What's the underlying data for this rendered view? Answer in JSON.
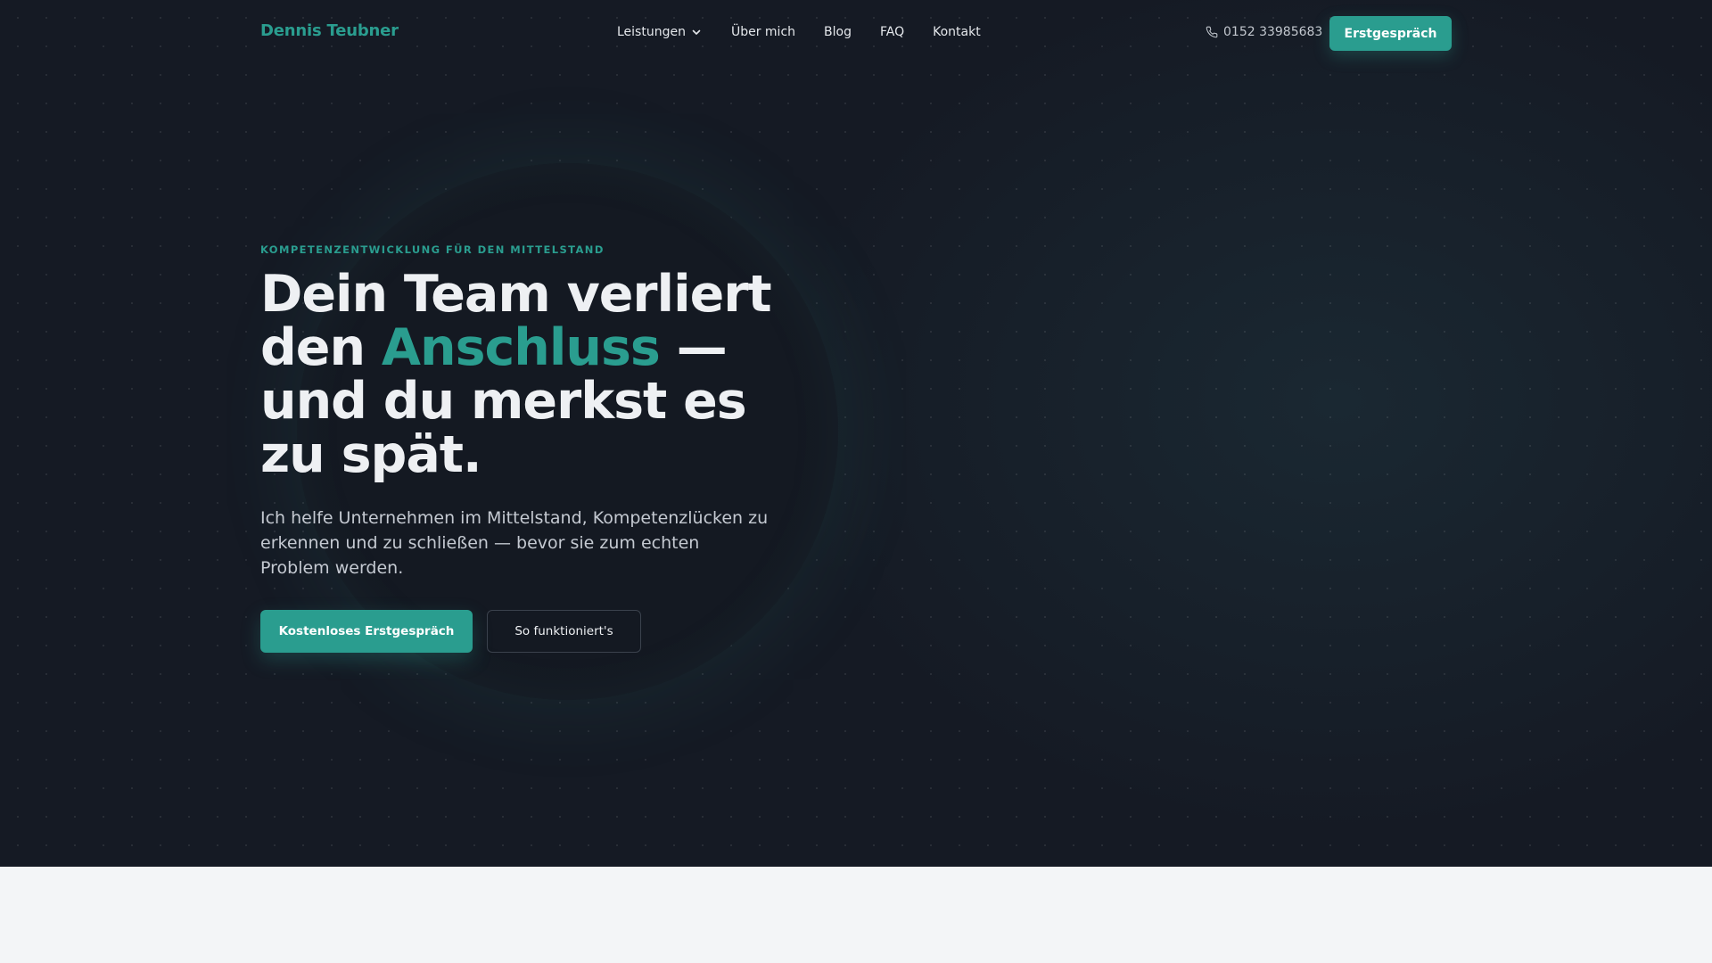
{
  "brand": {
    "name": "Dennis Teubner",
    "accent_color": "#2a9d8f",
    "background_color": "#151a24"
  },
  "nav": {
    "items": [
      {
        "label": "Leistungen",
        "has_dropdown": true
      },
      {
        "label": "Über mich"
      },
      {
        "label": "Blog"
      },
      {
        "label": "FAQ"
      },
      {
        "label": "Kontakt"
      }
    ],
    "phone": {
      "icon": "phone-icon",
      "number": "0152 33985683"
    },
    "cta_label": "Erstgespräch"
  },
  "hero": {
    "eyebrow": "KOMPETENZENTWICKLUNG FÜR DEN MITTELSTAND",
    "headline": {
      "part1": "Dein Team verliert den ",
      "accent": "Anschluss",
      "part2": " — und du merkst es zu spät."
    },
    "subtext": "Ich helfe Unternehmen im Mittelstand, Kompetenzlücken zu erkennen und zu schließen — bevor sie zum echten Problem werden.",
    "primary_cta": "Kostenloses Erstgespräch",
    "secondary_cta": "So funktioniert's"
  }
}
